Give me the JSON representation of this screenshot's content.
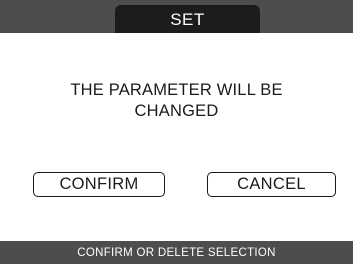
{
  "header": {
    "title": "SET"
  },
  "dialog": {
    "message_line_1": "THE PARAMETER WILL BE",
    "message_line_2": "CHANGED",
    "confirm_label": "CONFIRM",
    "cancel_label": "CANCEL"
  },
  "footer": {
    "hint": "CONFIRM OR DELETE SELECTION"
  },
  "colors": {
    "bar": "#4d4d4d",
    "title_tab": "#1c1c1c",
    "background": "#ffffff",
    "text": "#1a1a1a"
  }
}
